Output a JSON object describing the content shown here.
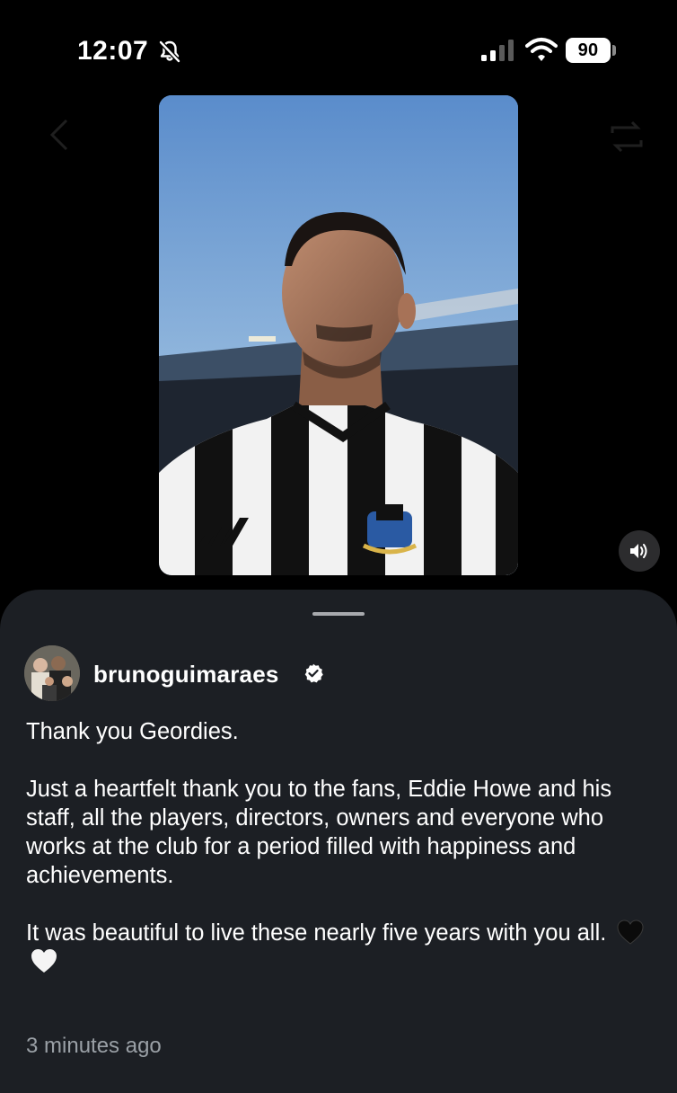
{
  "status_bar": {
    "time": "12:07",
    "battery": "90"
  },
  "media": {
    "description_alt": "video",
    "sound_button": "volume-icon"
  },
  "post": {
    "username": "brunoguimaraes",
    "verified": true,
    "caption": [
      "Thank you Geordies.",
      "Just a heartfelt thank you to the fans, Eddie Howe and his staff, all the players, directors, owners and everyone who works at the club for a period filled with happiness and achievements.",
      "It was beautiful to live these nearly five years with you all."
    ],
    "emoji": [
      "black-heart",
      "white-heart"
    ],
    "timestamp": "3 minutes ago"
  },
  "colors": {
    "sheet_background": "#1c1f24",
    "muted_text": "#9aa0a6",
    "background": "#000000"
  }
}
